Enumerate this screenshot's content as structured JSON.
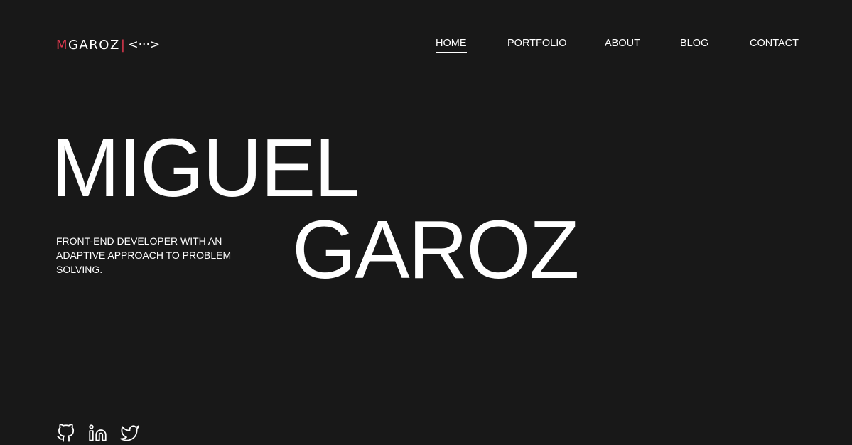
{
  "logo": {
    "first_letter": "M",
    "rest": "GAROZ",
    "separator": "|",
    "code_glyph": "<···>",
    "accent_color": "#e0384e"
  },
  "nav": {
    "items": [
      {
        "label": "HOME",
        "active": true
      },
      {
        "label": "PORTFOLIO"
      },
      {
        "label": "ABOUT"
      },
      {
        "label": "BLOG"
      },
      {
        "label": "CONTACT"
      }
    ]
  },
  "hero": {
    "line1": "MIGUEL",
    "line2": "GAROZ",
    "tagline": "FRONT-END DEVELOPER WITH AN ADAPTIVE APPROACH TO PROBLEM SOLVING."
  },
  "socials": {
    "icons": [
      "github-icon",
      "linkedin-icon",
      "twitter-icon"
    ]
  },
  "colors": {
    "background": "#181818",
    "text": "#ffffff",
    "accent": "#e0384e"
  }
}
